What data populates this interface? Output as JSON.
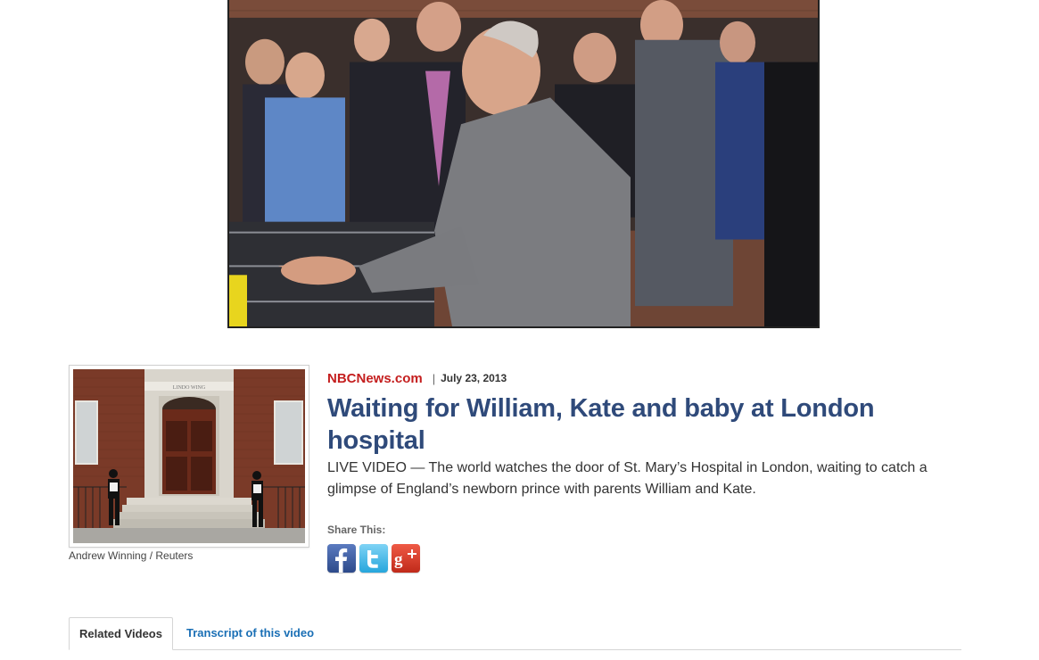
{
  "video": {
    "description_icon": "video-frame"
  },
  "story": {
    "thumbnail_caption": "Andrew Winning / Reuters",
    "thumbnail_sign": "LINDO WING",
    "source": "NBCNews.com",
    "separator": "|",
    "date": "July 23, 2013",
    "headline": "Waiting for William, Kate and baby at London hospital",
    "dek": "LIVE VIDEO — The world watches the door of St. Mary’s Hospital in London, waiting to catch a glimpse of England’s newborn prince with parents William and Kate."
  },
  "share": {
    "label": "Share This:",
    "buttons": [
      {
        "name": "facebook",
        "icon": "facebook-icon",
        "color": "#3b5998"
      },
      {
        "name": "twitter",
        "icon": "twitter-icon",
        "color": "#33b5e5"
      },
      {
        "name": "google-plus",
        "icon": "google-plus-icon",
        "color": "#d23a2a"
      }
    ]
  },
  "tabs": [
    {
      "label": "Related Videos",
      "active": true
    },
    {
      "label": "Transcript of this video",
      "active": false
    }
  ],
  "colors": {
    "source_red": "#c41e1e",
    "headline_blue": "#2f4a7a",
    "link_blue": "#1a6fb5"
  }
}
